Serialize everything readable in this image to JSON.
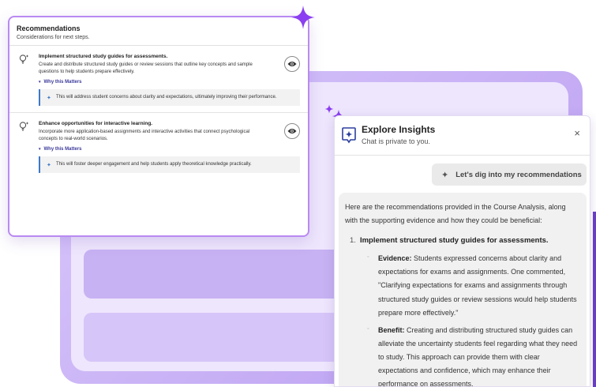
{
  "recommendations": {
    "title": "Recommendations",
    "subtitle": "Considerations for next steps.",
    "items": [
      {
        "title": "Implement structured study guides for assessments.",
        "description": "Create and distribute structured study guides or review sessions that outline key concepts and sample questions to help students prepare effectively.",
        "why_label": "Why this Matters",
        "why_text": "This will address student concerns about clarity and expectations, ultimately improving their performance."
      },
      {
        "title": "Enhance opportunities for interactive learning.",
        "description": "Incorporate more application-based assignments and interactive activities that connect psychological concepts to real-world scenarios.",
        "why_label": "Why this Matters",
        "why_text": "This will foster deeper engagement and help students apply theoretical knowledge practically."
      }
    ]
  },
  "insights": {
    "title": "Explore Insights",
    "subtitle": "Chat is private to you.",
    "close_icon": "×",
    "user_message": "Let's dig into my recommendations",
    "bot_intro": "Here are the recommendations provided in the Course Analysis, along with the supporting evidence and how they could be beneficial:",
    "list_number": "1.",
    "list_item": "Implement structured study guides for assessments.",
    "evidence_label": "Evidence:",
    "evidence_text": "Students expressed concerns about clarity and expectations for exams and assignments. One commented, \"Clarifying expectations for exams and assignments through structured study guides or review sessions would help students prepare more effectively.\"",
    "benefit_label": "Benefit:",
    "benefit_text": "Creating and distributing structured study guides can alleviate the uncertainty students feel regarding what they need to study. This approach can provide them with clear expectations and confidence, which may enhance their performance on assessments."
  },
  "colors": {
    "accent_purple": "#8b3ff0",
    "panel_lavender": "#d9c9fb",
    "link_indigo": "#3b3a9a",
    "evidence_bar_blue": "#3e78c8"
  },
  "icons": [
    "lightbulb-sparkle-icon",
    "eye-icon",
    "chevron-down-icon",
    "sparkle-icon",
    "insights-chat-icon",
    "close-icon",
    "plus-sparkle-icon"
  ]
}
